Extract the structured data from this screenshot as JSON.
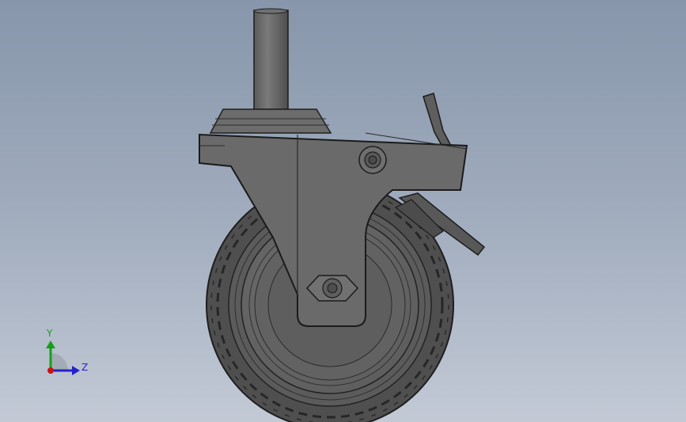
{
  "viewport": {
    "background_top": "#8796ab",
    "background_bottom": "#c3cad6",
    "model": "caster-wheel-with-brake"
  },
  "triad": {
    "y_label": "Y",
    "z_label": "Z",
    "y_color": "#14a014",
    "z_color": "#2323c8",
    "x_color": "#c81414"
  }
}
